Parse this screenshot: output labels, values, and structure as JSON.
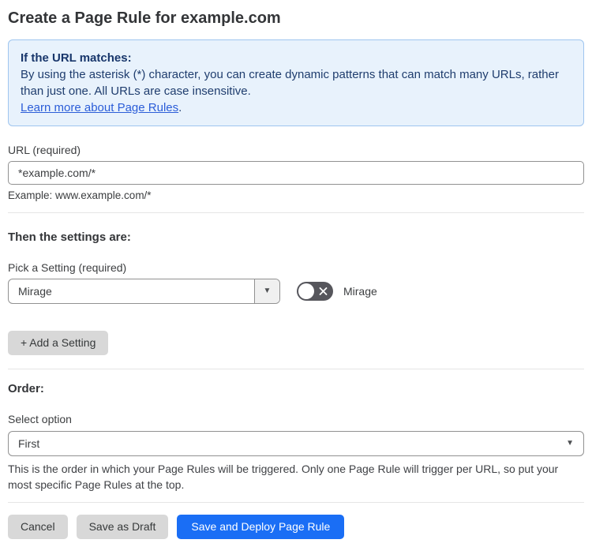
{
  "page": {
    "title": "Create a Page Rule for example.com"
  },
  "info_box": {
    "heading": "If the URL matches:",
    "body": "By using the asterisk (*) character, you can create dynamic patterns that can match many URLs, rather than just one. All URLs are case insensitive.",
    "link_label": "Learn more about Page Rules",
    "link_suffix": "."
  },
  "url_field": {
    "label": "URL (required)",
    "value": "*example.com/*",
    "helper": "Example: www.example.com/*"
  },
  "settings": {
    "heading": "Then the settings are:",
    "pick_label": "Pick a Setting (required)",
    "selected_setting": "Mirage",
    "toggle": {
      "state": "off",
      "label": "Mirage"
    },
    "add_button_label": "+ Add a Setting"
  },
  "order": {
    "heading": "Order:",
    "label": "Select option",
    "selected_option": "First",
    "helper": "This is the order in which your Page Rules will be triggered. Only one Page Rule will trigger per URL, so put your most specific Page Rules at the top."
  },
  "footer": {
    "cancel_label": "Cancel",
    "save_draft_label": "Save as Draft",
    "save_deploy_label": "Save and Deploy Page Rule"
  },
  "icons": {
    "dropdown_caret": "▼",
    "toggle_off_icon": "x-icon"
  },
  "colors": {
    "info_bg": "#e8f2fc",
    "info_border": "#9fc5ef",
    "info_text": "#1f3d6e",
    "link": "#2b5dd8",
    "primary_button": "#1a6ef5",
    "gray_button": "#d8d8d8",
    "toggle_off_bg": "#56565c",
    "input_border": "#919191",
    "divider": "#e5e5e5"
  }
}
